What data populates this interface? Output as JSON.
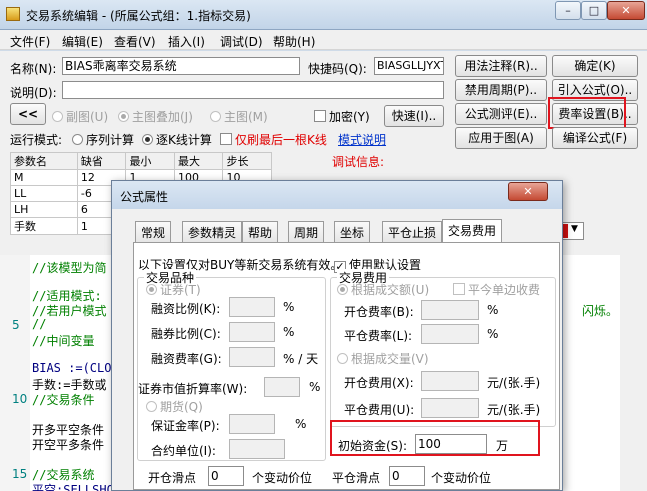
{
  "window": {
    "title": "交易系统编辑 - (所属公式组：1.指标交易)",
    "controls": [
      "–",
      "□",
      "✕"
    ]
  },
  "menu": [
    "文件(F)",
    "编辑(E)",
    "查看(V)",
    "插入(I)",
    "调试(D)",
    "帮助(H)"
  ],
  "form": {
    "name_label": "名称(N):",
    "name_value": "BIAS乖离率交易系统",
    "shortcut_label": "快捷码(Q):",
    "shortcut_value": "BIASGLLJYXT",
    "desc_label": "说明(D):",
    "nav_prev": "<<",
    "chart_opts": [
      "副图(U)",
      "主图叠加(J)",
      "主图(M)"
    ],
    "encrypt": "加密(Y)",
    "run_mode_label": "运行模式:",
    "run_modes": [
      "序列计算",
      "逐K线计算"
    ],
    "last_bar_only": "仅刷最后一根K线",
    "mode_help": "模式说明",
    "debug_info": "调试信息:"
  },
  "buttons": {
    "usage": "用法注释(R)..",
    "confirm": "确定(K)",
    "disable_period": "禁用周期(P)..",
    "import": "引入公式(O)..",
    "quick": "快速(I)..",
    "test": "公式测评(E)..",
    "fee": "费率设置(B)..",
    "apply": "应用于图(A)",
    "compile": "编译公式(F)"
  },
  "params": {
    "headers": [
      "参数名",
      "缺省",
      "最小",
      "最大",
      "步长"
    ],
    "rows": [
      [
        "M",
        "12",
        "1",
        "100",
        "10"
      ],
      [
        "LL",
        "-6",
        "",
        "",
        ""
      ],
      [
        "LH",
        "6",
        "",
        "",
        ""
      ],
      [
        "手数",
        "1",
        "",
        "",
        ""
      ]
    ]
  },
  "code": {
    "line_numbers": [
      "5",
      "10",
      "15"
    ],
    "lines": [
      "//该模型为简",
      "//适用模式:",
      "//若用户模式",
      "//",
      "//中间变量",
      "BIAS :=(CLOS",
      "手数:=手数或",
      "//交易条件",
      "开多平空条件",
      "开空平多条件",
      "//交易系统",
      "平空:SELLSHO"
    ],
    "tail_text": "闪烁。"
  },
  "dialog": {
    "title": "公式属性",
    "close": "✕",
    "tabs": [
      "常规",
      "参数精灵",
      "帮助",
      "周期",
      "坐标",
      "平仓止损",
      "交易费用"
    ],
    "note": "以下设置仅对BUY等新交易系统有效。",
    "use_default": "使用默认设置",
    "left_group": "交易品种",
    "securities": "证券(T)",
    "margin_ratio": "融资比例(K):",
    "short_ratio": "融券比例(C):",
    "margin_rate": "融资费率(G):",
    "per_day": "% / 天",
    "market_rate": "证券市值折算率(W):",
    "futures": "期货(Q)",
    "deposit_rate": "保证金率(P):",
    "contract_unit": "合约单位(I):",
    "right_group": "交易费用",
    "by_amount": "根据成交额(U)",
    "close_today": "平今单边收费",
    "open_fee_rate": "开仓费率(B):",
    "close_fee_rate": "平仓费率(L):",
    "by_volume": "根据成交量(V)",
    "open_fee": "开仓费用(X):",
    "close_fee": "平仓费用(U):",
    "per_lot": "元/(张.手)",
    "percent": "%",
    "initial_capital_label": "初始资金(S):",
    "initial_capital": "100",
    "wan": "万",
    "open_slip_label": "开仓滑点",
    "open_slip": "0",
    "close_slip_label": "平仓滑点",
    "close_slip": "0",
    "tick_unit": "个变动价位"
  },
  "colors": {
    "highlight": "#e0141e",
    "titlebar": "#c5d6ea"
  }
}
